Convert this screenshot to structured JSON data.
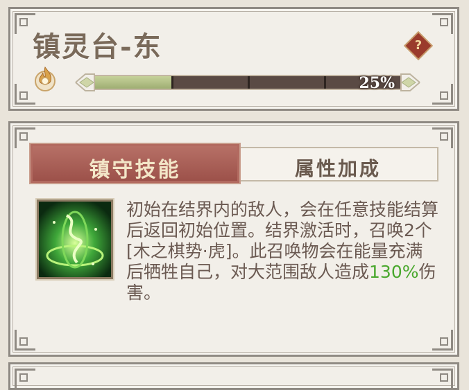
{
  "header": {
    "title": "镇灵台-东",
    "help_label": "?",
    "progress_label": "25%",
    "progress_fraction": 0.25,
    "progress_segments": 4
  },
  "tabs": [
    {
      "label": "镇守技能",
      "active": true
    },
    {
      "label": "属性加成",
      "active": false
    }
  ],
  "skill": {
    "icon": "green-vortex-skill-icon",
    "desc_part1": "初始在结界内的敌人，会在任意技能结算后返回初始位置。结界激活时，召唤2个[木之棋势·虎]。此召唤物会在能量充满后牺牲自己，对大范围敌人造成",
    "desc_highlight": "130%",
    "desc_part2": "伤害。"
  },
  "colors": {
    "accent_red": "#9b4f48",
    "highlight_green": "#4aa82e",
    "progress_green": "#b7c387"
  }
}
